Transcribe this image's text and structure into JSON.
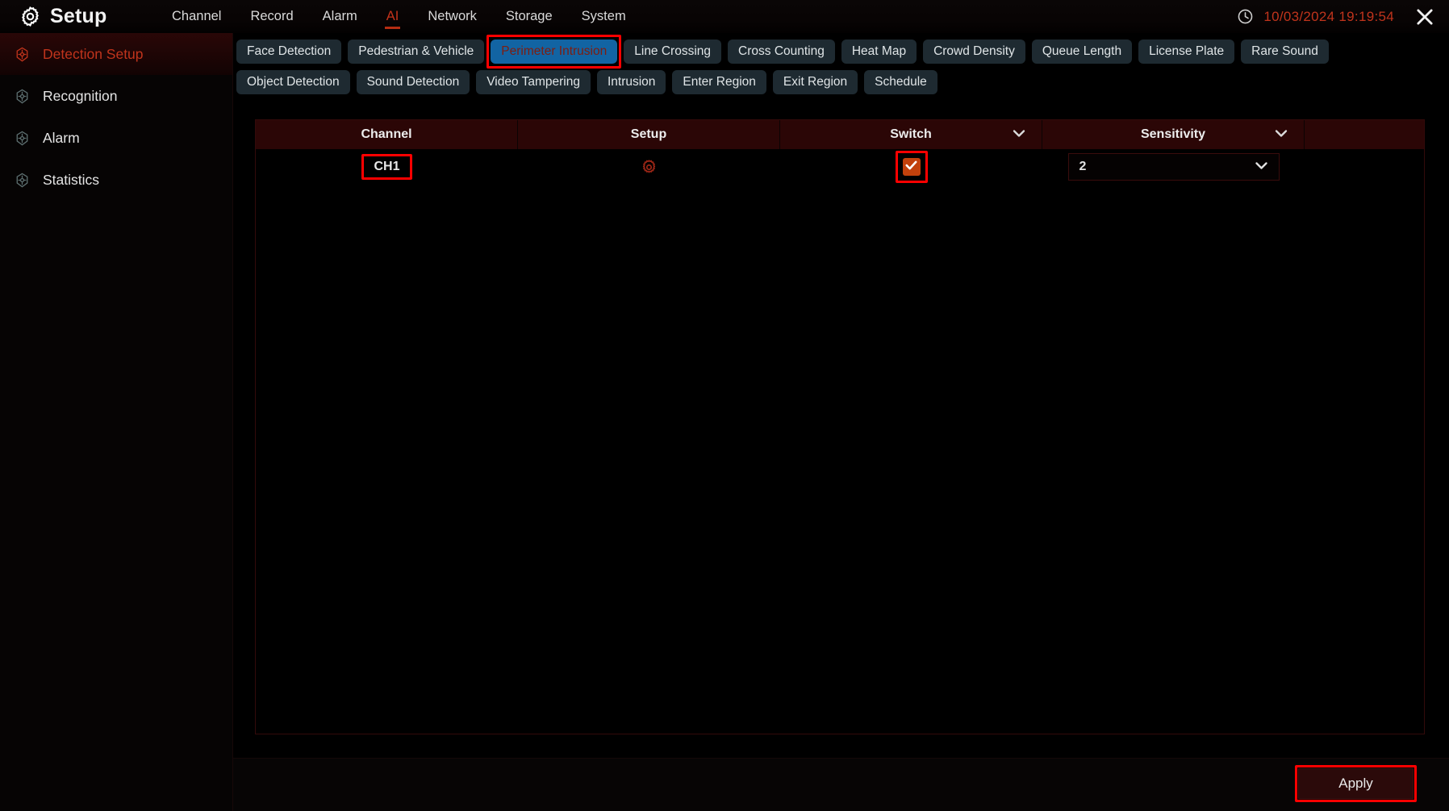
{
  "window": {
    "app_icon": "gear-icon",
    "title": "Setup",
    "clock_icon": "clock-icon",
    "datetime": "10/03/2024 19:19:54",
    "close_icon": "close-icon"
  },
  "mainnav": {
    "items": [
      {
        "label": "Channel",
        "active": false
      },
      {
        "label": "Record",
        "active": false
      },
      {
        "label": "Alarm",
        "active": false
      },
      {
        "label": "AI",
        "active": true
      },
      {
        "label": "Network",
        "active": false
      },
      {
        "label": "Storage",
        "active": false
      },
      {
        "label": "System",
        "active": false
      }
    ]
  },
  "sidebar": {
    "items": [
      {
        "label": "Detection Setup",
        "icon": "target-icon",
        "active": true
      },
      {
        "label": "Recognition",
        "icon": "target-icon",
        "active": false
      },
      {
        "label": "Alarm",
        "icon": "target-icon",
        "active": false
      },
      {
        "label": "Statistics",
        "icon": "target-icon",
        "active": false
      }
    ]
  },
  "tabs": {
    "row1": [
      {
        "label": "Face Detection",
        "selected": false
      },
      {
        "label": "Pedestrian & Vehicle",
        "selected": false
      },
      {
        "label": "Perimeter Intrusion",
        "selected": true,
        "highlighted": true
      },
      {
        "label": "Line Crossing",
        "selected": false
      },
      {
        "label": "Cross Counting",
        "selected": false
      },
      {
        "label": "Heat Map",
        "selected": false
      },
      {
        "label": "Crowd Density",
        "selected": false
      },
      {
        "label": "Queue Length",
        "selected": false
      },
      {
        "label": "License Plate",
        "selected": false
      },
      {
        "label": "Rare Sound",
        "selected": false
      }
    ],
    "row2": [
      {
        "label": "Object Detection",
        "selected": false
      },
      {
        "label": "Sound Detection",
        "selected": false
      },
      {
        "label": "Video Tampering",
        "selected": false
      },
      {
        "label": "Intrusion",
        "selected": false
      },
      {
        "label": "Enter Region",
        "selected": false
      },
      {
        "label": "Exit Region",
        "selected": false
      },
      {
        "label": "Schedule",
        "selected": false
      }
    ]
  },
  "table": {
    "headers": {
      "channel": "Channel",
      "setup": "Setup",
      "switch": "Switch",
      "sensitivity": "Sensitivity"
    },
    "header_dropdowns": {
      "switch_icon": "chevron-down-icon",
      "sensitivity_icon": "chevron-down-icon"
    },
    "rows": [
      {
        "channel": "CH1",
        "setup_icon": "gear-icon",
        "switch_checked": true,
        "switch_icon": "check-icon",
        "sensitivity": "2",
        "sensitivity_icon": "chevron-down-icon"
      }
    ]
  },
  "footer": {
    "apply_label": "Apply"
  },
  "colors": {
    "accent_red": "#c0341c",
    "annotation_red": "#ff0000",
    "tab_selected_blue": "#1264a3",
    "chip_bg": "#1e2a31",
    "header_maroon": "#2b0606",
    "checkbox_orange": "#c2410c"
  }
}
